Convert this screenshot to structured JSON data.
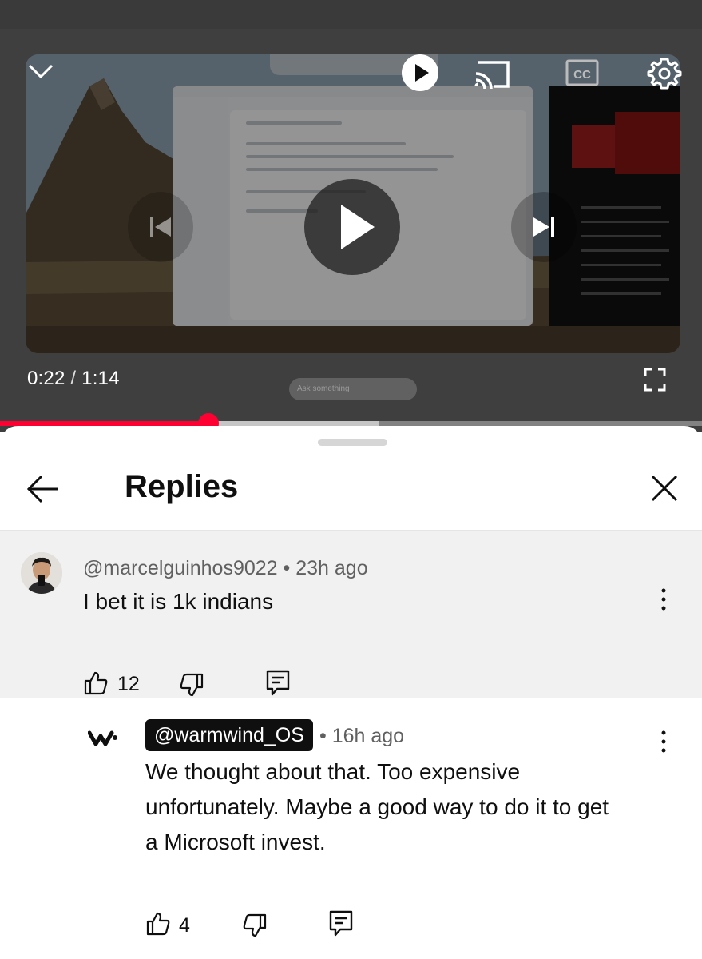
{
  "player": {
    "elapsed": "0:22",
    "separator": "/",
    "duration": "1:14",
    "ask_placeholder": "Ask something",
    "progress_fraction": 0.297,
    "buffer_fraction": 0.54,
    "icons": [
      "chevron-down-icon",
      "play-icon",
      "cast-icon",
      "closed-captions-icon",
      "gear-icon",
      "skip-previous-icon",
      "play-icon",
      "skip-next-icon",
      "fullscreen-icon"
    ]
  },
  "sheet": {
    "title": "Replies"
  },
  "comment": {
    "author": "@marcelguinhos9022",
    "time": "• 23h ago",
    "text": "I bet it is 1k indians",
    "likes": "12"
  },
  "reply": {
    "author": "@warmwind_OS",
    "time": "• 16h ago",
    "lines": [
      "We thought about that. Too expensive",
      "unfortunately. Maybe a good way to do it to get",
      "a Microsoft invest."
    ],
    "likes": "4"
  },
  "colors": {
    "accent": "#ff0033",
    "text_primary": "#0f0f0f",
    "text_secondary": "#606060",
    "parent_bg": "#f1f1f1"
  }
}
